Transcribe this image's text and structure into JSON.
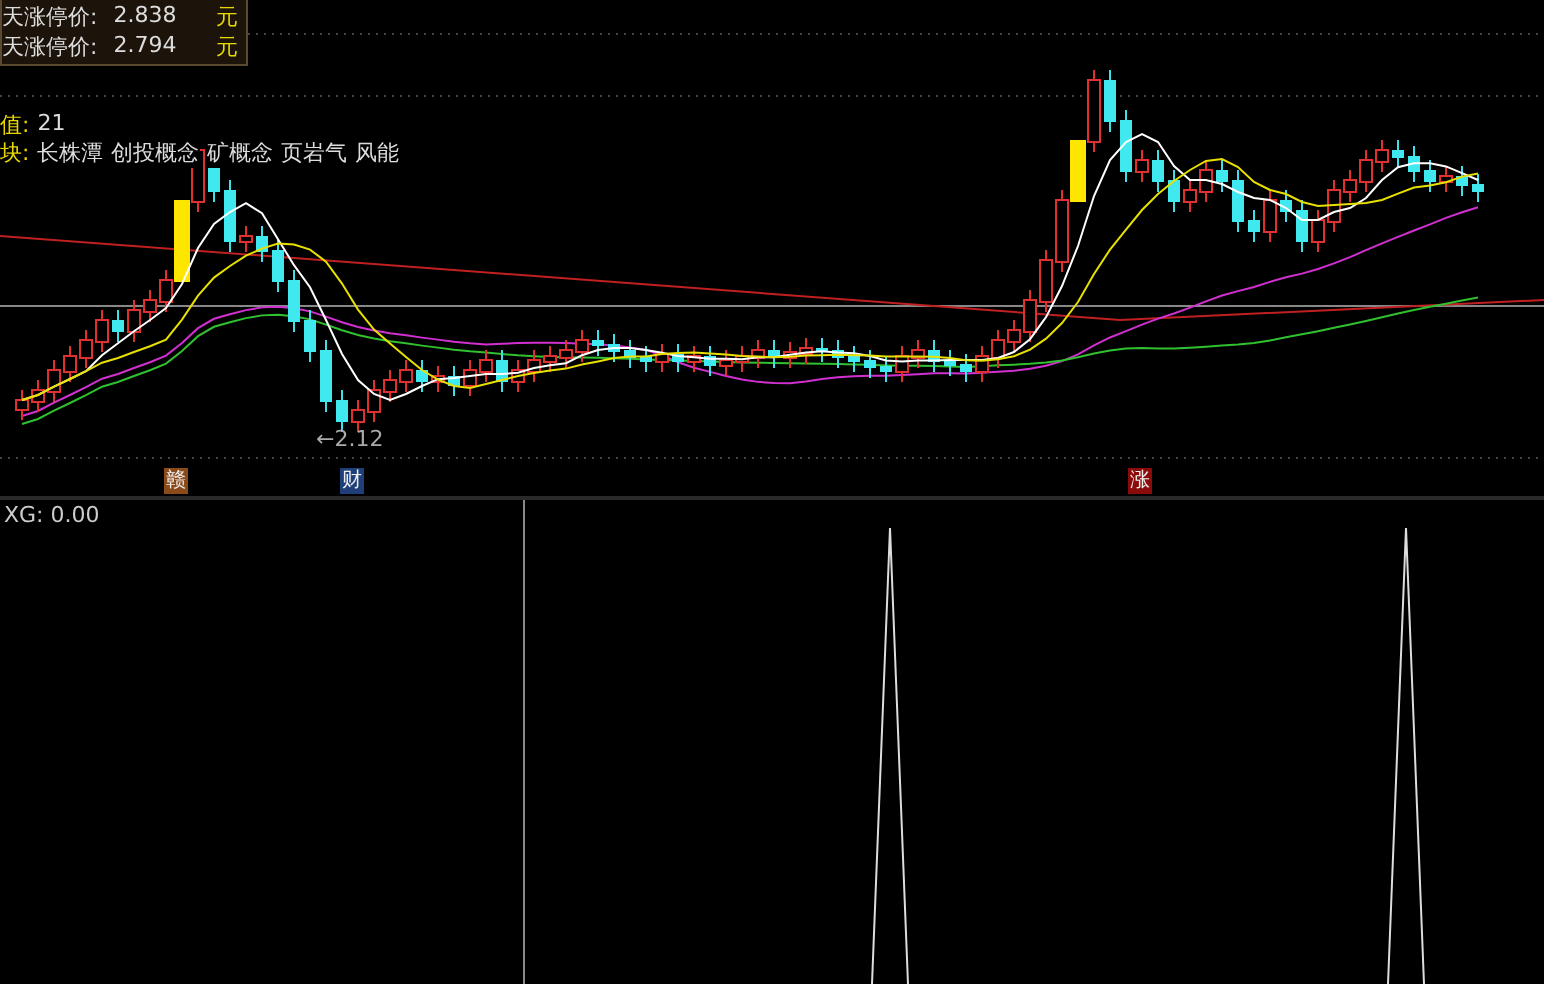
{
  "info_box": {
    "rows": [
      {
        "label": "天涨停价:",
        "value": "2.838",
        "unit": "元"
      },
      {
        "label": "天涨停价:",
        "value": "2.794",
        "unit": "元"
      }
    ]
  },
  "indicators": {
    "value_label": "值:",
    "value": "21",
    "sector_label": "块:",
    "sectors": [
      "长株潭",
      "创投概念",
      "矿概念",
      "页岩气",
      "风能"
    ]
  },
  "price_chart": {
    "low_label": "←2.12",
    "markers": [
      {
        "text": "赣",
        "color": "#8b4a1a"
      },
      {
        "text": "财",
        "color": "#1f3f78"
      },
      {
        "text": "涨",
        "color": "#8b0a0a"
      }
    ]
  },
  "indicator_panel": {
    "label": "XG: 0.00"
  }
}
